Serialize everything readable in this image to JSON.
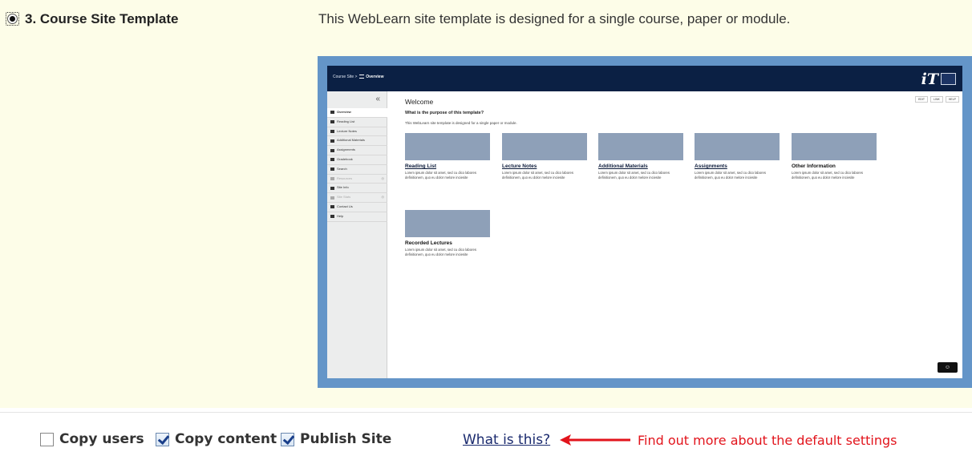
{
  "template": {
    "title": "3. Course Site Template",
    "description": "This WebLearn site template is designed for a single course, paper or module.",
    "selected": true
  },
  "preview": {
    "breadcrumb_site": "Course Site",
    "breadcrumb_sep": ">",
    "breadcrumb_page": "Overview",
    "logo": "iT",
    "collapse_glyph": "«",
    "nav": [
      {
        "label": "Overview",
        "icon": "menu-icon",
        "active": true,
        "dim": false,
        "extra": ""
      },
      {
        "label": "Reading List",
        "icon": "list-icon",
        "active": false,
        "dim": false,
        "extra": ""
      },
      {
        "label": "Lecture Notes",
        "icon": "list-icon",
        "active": false,
        "dim": false,
        "extra": ""
      },
      {
        "label": "Additional Materials",
        "icon": "list-icon",
        "active": false,
        "dim": false,
        "extra": ""
      },
      {
        "label": "Assignments",
        "icon": "assignment-icon",
        "active": false,
        "dim": false,
        "extra": ""
      },
      {
        "label": "Gradebook",
        "icon": "gradebook-icon",
        "active": false,
        "dim": false,
        "extra": ""
      },
      {
        "label": "Search",
        "icon": "search-icon",
        "active": false,
        "dim": false,
        "extra": ""
      },
      {
        "label": "Resources",
        "icon": "folder-icon",
        "active": false,
        "dim": true,
        "extra": "◎"
      },
      {
        "label": "Site Info",
        "icon": "gear-icon",
        "active": false,
        "dim": false,
        "extra": ""
      },
      {
        "label": "Site Stats",
        "icon": "chart-icon",
        "active": false,
        "dim": true,
        "extra": "◎"
      },
      {
        "label": "Contact Us",
        "icon": "mail-icon",
        "active": false,
        "dim": false,
        "extra": ""
      },
      {
        "label": "Help",
        "icon": "help-icon",
        "active": false,
        "dim": false,
        "extra": ""
      }
    ],
    "actions": [
      "EDIT",
      "LINK",
      "HELP"
    ],
    "welcome": "Welcome",
    "question": "What is the purpose of this template?",
    "intro": "This WebLearn site template is designed for a single paper or module.",
    "cards": [
      {
        "title": "Reading List",
        "link": true,
        "body": "Lorem ipsum dolor sit amet, sed cu dico labores definitionem, quo eu dolor melore inciesite"
      },
      {
        "title": "Lecture Notes",
        "link": true,
        "body": "Lorem ipsum dolor sit amet, sed cu dico labores definitionem, quo eu dolor melore inciesite"
      },
      {
        "title": "Additional Materials",
        "link": true,
        "body": "Lorem ipsum dolor sit amet, sed cu dico labores definitionem, quo eu dolor melore inciesite"
      },
      {
        "title": "Assignments",
        "link": true,
        "body": "Lorem ipsum dolor sit amet, sed cu dico labores definitionem, quo eu dolor melore inciesite"
      },
      {
        "title": "Other Information",
        "link": false,
        "body": "Lorem ipsum dolor sit amet, sed cu dico labores definitionem, quo eu dolor melore inciesite"
      },
      {
        "title": "Recorded Lectures",
        "link": false,
        "body": "Lorem ipsum dolor sit amet, sed cu dico labores definitionem, quo eu dolor melore inciesite"
      }
    ],
    "chat_glyph": "☺"
  },
  "options": {
    "copy_users": {
      "label": "Copy users",
      "checked": false
    },
    "copy_content": {
      "label": "Copy content",
      "checked": true
    },
    "publish_site": {
      "label": "Publish Site",
      "checked": true
    },
    "help_link": "What is this?",
    "note": "Find out more about the default settings"
  },
  "colors": {
    "panel_bg": "#fdfde8",
    "frame": "#6495c8",
    "topbar": "#0b2044",
    "note_red": "#e2141c"
  }
}
